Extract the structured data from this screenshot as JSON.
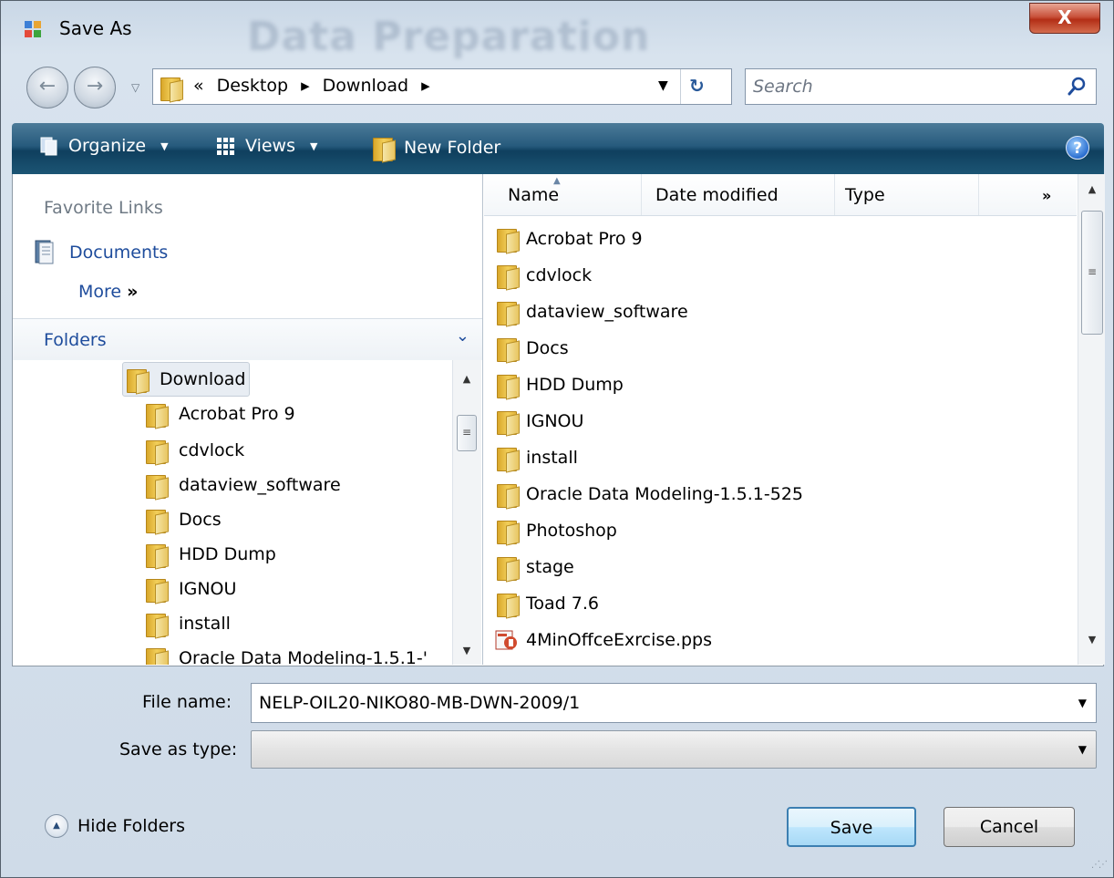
{
  "window": {
    "title": "Save As",
    "background_title": "Data Preparation",
    "close_label": "X"
  },
  "address": {
    "overflow_marker": "«",
    "crumbs": [
      "Desktop",
      "Download"
    ],
    "separator": "▸"
  },
  "search": {
    "placeholder": "Search"
  },
  "toolbar": {
    "organize_label": "Organize",
    "views_label": "Views",
    "new_folder_label": "New Folder",
    "help_label": "?"
  },
  "favorites": {
    "title": "Favorite Links",
    "items": [
      {
        "label": "Documents",
        "icon": "documents-icon"
      }
    ],
    "more_label": "More",
    "more_glyph": "»"
  },
  "folders": {
    "title": "Folders",
    "tree": [
      {
        "label": "Download",
        "level": 0,
        "selected": true
      },
      {
        "label": "Acrobat Pro 9",
        "level": 1
      },
      {
        "label": "cdvlock",
        "level": 1
      },
      {
        "label": "dataview_software",
        "level": 1
      },
      {
        "label": "Docs",
        "level": 1
      },
      {
        "label": "HDD Dump",
        "level": 1
      },
      {
        "label": "IGNOU",
        "level": 1
      },
      {
        "label": "install",
        "level": 1
      },
      {
        "label": "Oracle Data Modeling-1.5.1-'",
        "level": 1
      }
    ]
  },
  "file_list": {
    "columns": [
      "Name",
      "Date modified",
      "Type"
    ],
    "more_columns_glyph": "»",
    "items": [
      {
        "name": "Acrobat Pro 9",
        "icon": "folder-icon"
      },
      {
        "name": "cdvlock",
        "icon": "folder-icon"
      },
      {
        "name": "dataview_software",
        "icon": "folder-icon"
      },
      {
        "name": "Docs",
        "icon": "folder-icon"
      },
      {
        "name": "HDD Dump",
        "icon": "folder-icon"
      },
      {
        "name": "IGNOU",
        "icon": "folder-icon"
      },
      {
        "name": "install",
        "icon": "folder-icon"
      },
      {
        "name": "Oracle Data Modeling-1.5.1-525",
        "icon": "folder-icon"
      },
      {
        "name": "Photoshop",
        "icon": "folder-icon"
      },
      {
        "name": "stage",
        "icon": "folder-icon"
      },
      {
        "name": "Toad 7.6",
        "icon": "folder-icon"
      },
      {
        "name": "4MinOffceExrcise.pps",
        "icon": "powerpoint-icon"
      }
    ]
  },
  "form": {
    "file_name_label": "File name:",
    "file_name_value": "NELP-OIL20-NIKO80-MB-DWN-2009/1",
    "save_type_label": "Save as type:",
    "save_type_value": ""
  },
  "footer": {
    "hide_folders_label": "Hide Folders",
    "save_label": "Save",
    "cancel_label": "Cancel"
  },
  "colors": {
    "toolbar": "#1c5574",
    "link": "#1e4c9c",
    "close_button": "#c9523b",
    "save_button_border": "#3c7fb1"
  }
}
